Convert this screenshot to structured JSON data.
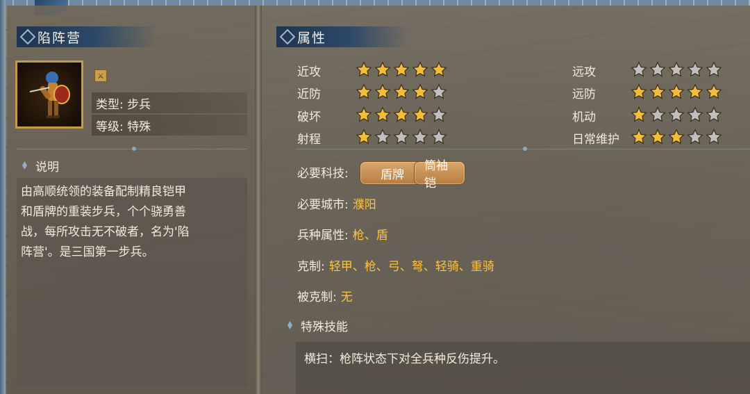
{
  "left": {
    "title": "陷阵营",
    "type_line": "类型: 步兵",
    "level_line": "等级: 特殊",
    "desc_heading": "说明",
    "description_lines": [
      "由高顺统领的装备配制精良铠甲",
      "和盾牌的重装步兵，个个骁勇善",
      "战，每所攻击无不破者，名为'陷",
      "阵营'。是三国第一步兵。"
    ]
  },
  "right": {
    "title": "属性",
    "stats_left": [
      {
        "label": "近攻",
        "stars": 5
      },
      {
        "label": "近防",
        "stars": 4
      },
      {
        "label": "破坏",
        "stars": 4
      },
      {
        "label": "射程",
        "stars": 1
      }
    ],
    "stats_right": [
      {
        "label": "远攻",
        "stars": 0
      },
      {
        "label": "远防",
        "stars": 5
      },
      {
        "label": "机动",
        "stars": 1
      },
      {
        "label": "日常维护",
        "stars": 3
      }
    ],
    "tech_label": "必要科技:",
    "tech_buttons": [
      "盾牌",
      "筒袖铠"
    ],
    "city_label": "必要城市:",
    "city_value": "濮阳",
    "attr_label": "兵种属性:",
    "attr_value": "枪、盾",
    "counters_label": "克制:",
    "counters_value": "轻甲、枪、弓、弩、轻骑、重骑",
    "countered_label": "被克制:",
    "countered_value": "无",
    "skill_heading": "特殊技能",
    "skill_text": "横扫：枪阵状态下对全兵种反伤提升。"
  },
  "colors": {
    "star_on": "#f3bd3a",
    "star_off": "#bfbfbf",
    "value_yellow": "#ffc23e",
    "header_blue": "#2c4968"
  },
  "icons": {
    "badge": "sword-badge-icon",
    "star": "star-icon"
  }
}
